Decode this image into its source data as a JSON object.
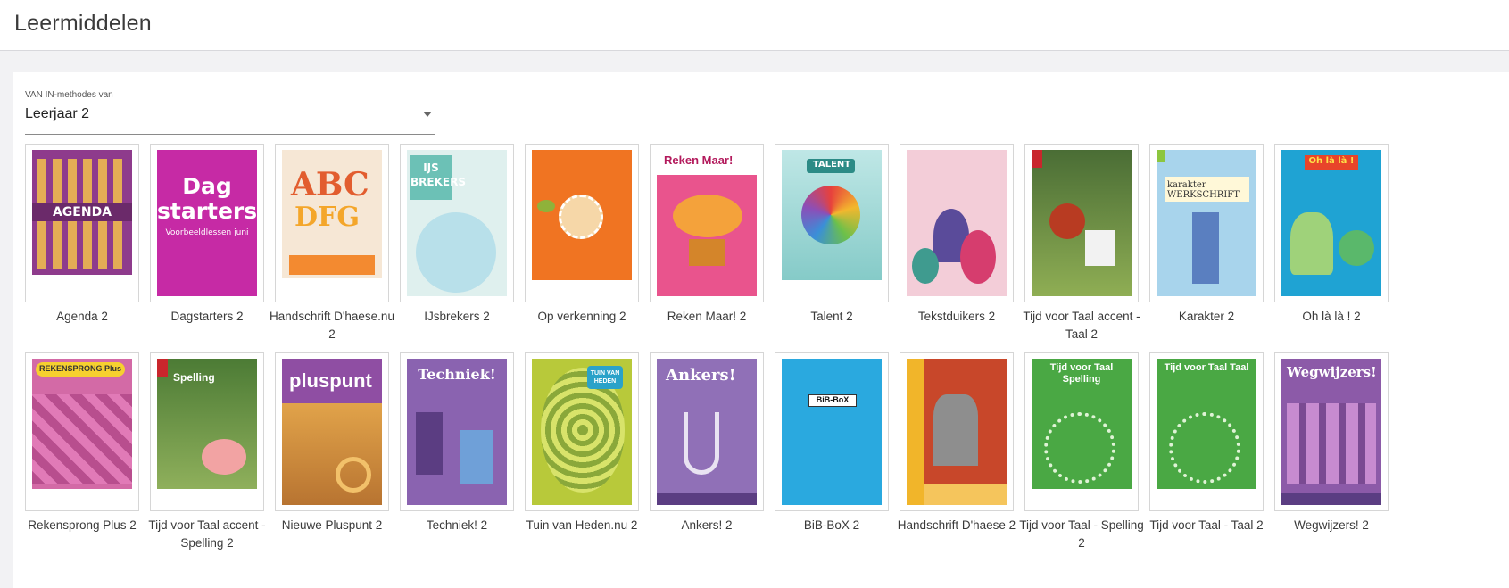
{
  "page": {
    "title": "Leermiddelen"
  },
  "filter": {
    "label": "VAN IN-methodes van",
    "value": "Leerjaar 2"
  },
  "covers": {
    "agenda": "AGENDA",
    "dag_line1": "Dag",
    "dag_line2": "starters",
    "dag_sub": "Voorbeeldlessen juni",
    "ijs": "IJS BREKERS",
    "reken": "Reken Maar!",
    "talent": "TALENT",
    "karakter": "karakter WERKSCHRIFT",
    "ohla": "Oh là là !",
    "rekensprong": "REKENSPRONG Plus",
    "spelling": "Spelling",
    "pluspunt": "pluspunt",
    "techniek": "Techniek!",
    "tuin": "TUIN VAN HEDEN",
    "ankers": "Ankers!",
    "bibbox": "BiB-BoX",
    "tvt_spelling": "Tijd voor Taal Spelling",
    "tvt_taal": "Tijd voor Taal Taal",
    "wegwijzers": "Wegwijzers!"
  },
  "books": [
    {
      "id": "agenda",
      "title": "Agenda 2",
      "color": "#8e3b8c"
    },
    {
      "id": "dagstarters",
      "title": "Dagstarters 2",
      "color": "#c62aa5"
    },
    {
      "id": "handschrift",
      "title": "Handschrift D'haese.nu 2",
      "color": "#f6e7d5"
    },
    {
      "id": "ijsbrekers",
      "title": "IJsbrekers 2",
      "color": "#9fd6cf"
    },
    {
      "id": "opverkenning",
      "title": "Op verkenning 2",
      "color": "#f07422"
    },
    {
      "id": "rekenmaar",
      "title": "Reken Maar! 2",
      "color": "#e3467a"
    },
    {
      "id": "talent",
      "title": "Talent 2",
      "color": "#55b9b1"
    },
    {
      "id": "tekstduikers",
      "title": "Tekstduikers 2",
      "color": "#e9b3c6"
    },
    {
      "id": "tvtaccent",
      "title": "Tijd voor Taal accent - Taal 2",
      "color": "#5f7f3e"
    },
    {
      "id": "karakter",
      "title": "Karakter 2",
      "color": "#8ec4e0"
    },
    {
      "id": "ohlala",
      "title": "Oh là là ! 2",
      "color": "#1fa3d3"
    },
    {
      "id": "rekensprong",
      "title": "Rekensprong Plus 2",
      "color": "#d36aa6"
    },
    {
      "id": "tvtspellingaccent",
      "title": "Tijd voor Taal accent - Spelling 2",
      "color": "#5a8a3c"
    },
    {
      "id": "pluspunt",
      "title": "Nieuwe Pluspunt 2",
      "color": "#7a3e8e"
    },
    {
      "id": "techniek",
      "title": "Techniek! 2",
      "color": "#8a63b0"
    },
    {
      "id": "tuin",
      "title": "Tuin van Heden.nu 2",
      "color": "#b8c93a"
    },
    {
      "id": "ankers",
      "title": "Ankers! 2",
      "color": "#9070b7"
    },
    {
      "id": "bibbox",
      "title": "BiB-BoX 2",
      "color": "#2aa9df"
    },
    {
      "id": "handschrift2",
      "title": "Handschrift D'haese 2",
      "color": "#c8472a"
    },
    {
      "id": "tvtspelling",
      "title": "Tijd voor Taal - Spelling 2",
      "color": "#4aa844"
    },
    {
      "id": "tvttaal",
      "title": "Tijd voor Taal - Taal 2",
      "color": "#4aa844"
    },
    {
      "id": "wegwijzers",
      "title": "Wegwijzers! 2",
      "color": "#8c5aa8"
    }
  ]
}
